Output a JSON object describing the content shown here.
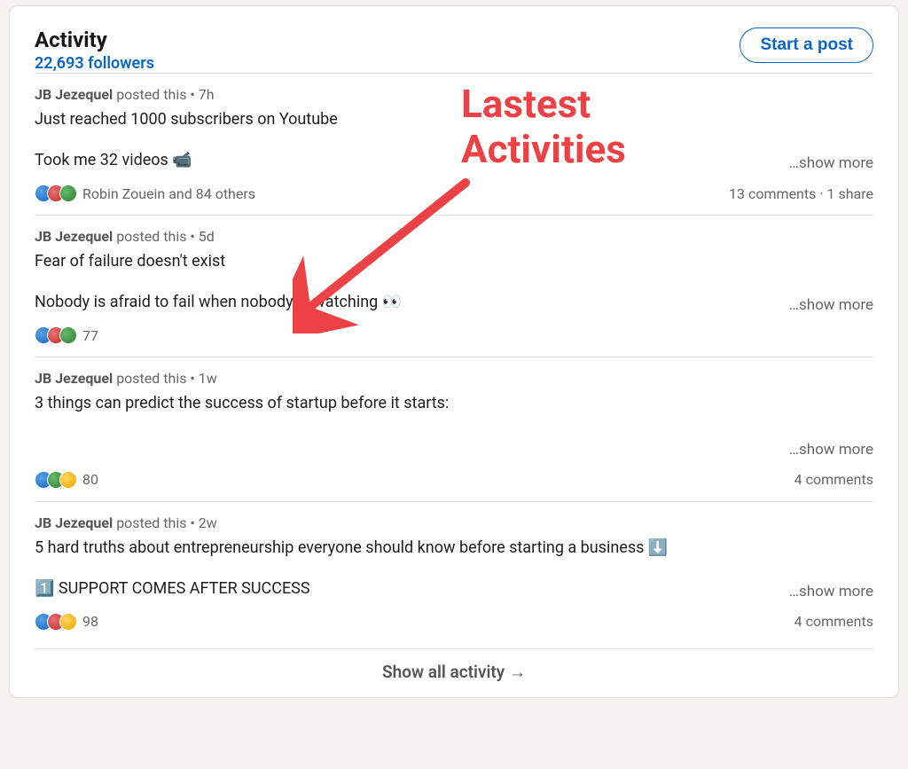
{
  "header": {
    "title": "Activity",
    "followers": "22,693 followers",
    "start_post": "Start a post"
  },
  "annotation": {
    "line1": "Lastest",
    "line2": "Activities"
  },
  "posts": [
    {
      "author": "JB Jezequel",
      "byline_suffix": " posted this • 7h",
      "line1": "Just reached 1000 subscribers on Youtube",
      "line2": "Took me 32 videos 📹",
      "show_more": "…show more",
      "reaction_text": "Robin Zouein and 84 others",
      "meta_comments": "13 comments",
      "meta_shares": "1 share",
      "icons": [
        "like",
        "love",
        "celebrate"
      ]
    },
    {
      "author": "JB Jezequel",
      "byline_suffix": " posted this • 5d",
      "line1": "Fear of failure doesn't exist",
      "line2": "Nobody is afraid to fail when nobody is watching 👀",
      "show_more": "…show more",
      "reaction_text": "77",
      "meta_comments": "",
      "meta_shares": "",
      "icons": [
        "like",
        "love",
        "celebrate"
      ]
    },
    {
      "author": "JB Jezequel",
      "byline_suffix": " posted this • 1w",
      "line1": "3 things can predict the success of startup before it starts:",
      "line2": "",
      "show_more": "…show more",
      "reaction_text": "80",
      "meta_comments": "4 comments",
      "meta_shares": "",
      "icons": [
        "like",
        "celebrate",
        "idea"
      ]
    },
    {
      "author": "JB Jezequel",
      "byline_suffix": " posted this • 2w",
      "line1": "5 hard truths about entrepreneurship everyone should know before starting a business ⬇️",
      "line2": "1️⃣ SUPPORT COMES AFTER SUCCESS",
      "show_more": "…show more",
      "reaction_text": "98",
      "meta_comments": "4 comments",
      "meta_shares": "",
      "icons": [
        "like",
        "love",
        "idea"
      ]
    }
  ],
  "footer": {
    "show_all": "Show all activity →"
  }
}
